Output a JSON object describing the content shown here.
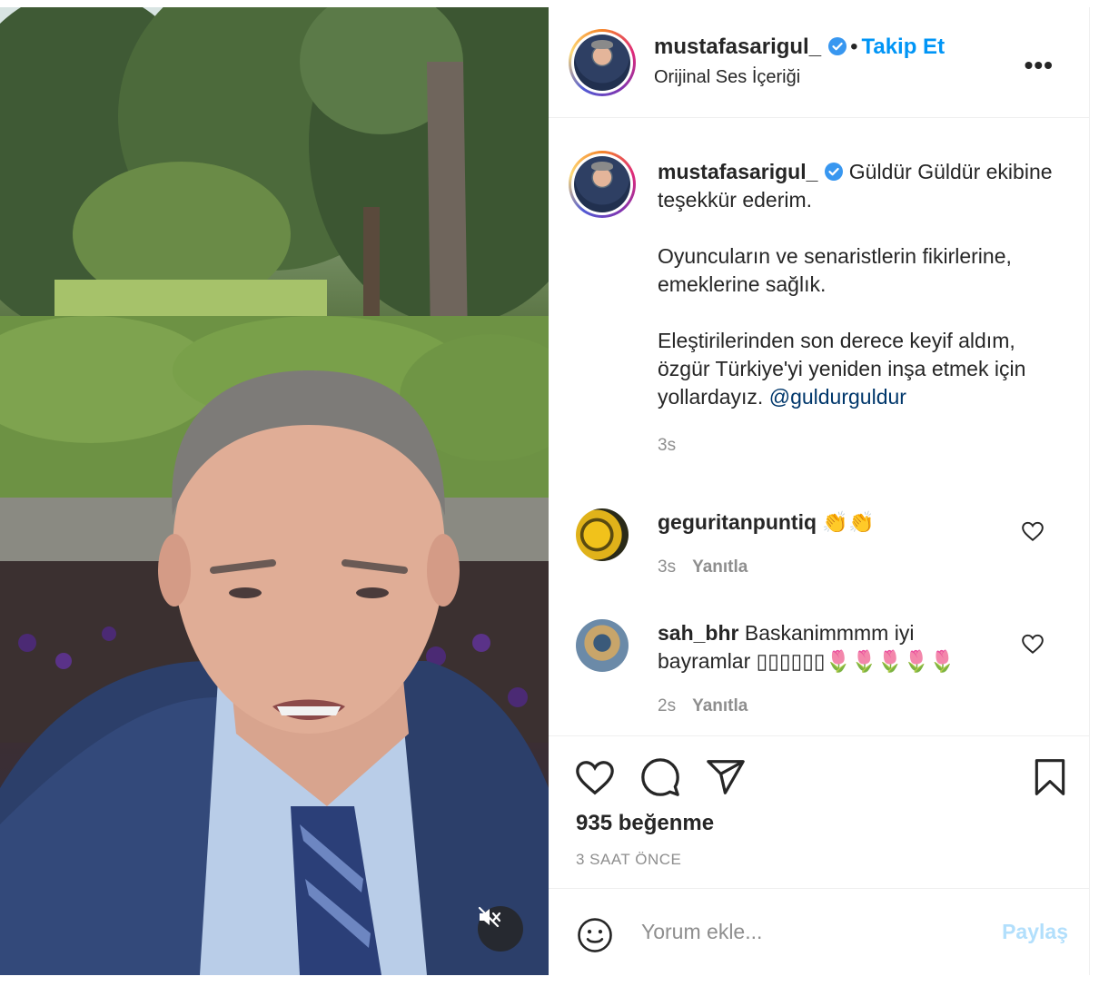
{
  "post": {
    "username": "mustafasarigul_",
    "follow_label": "Takip Et",
    "separator": "•",
    "audio_label": "Orijinal Ses İçeriği",
    "more_label": "•••"
  },
  "caption": {
    "username": "mustafasarigul_",
    "line1": "Güldür Güldür ekibine teşekkür ederim.",
    "line2": "Oyuncuların ve senaristlerin fikirlerine, emeklerine sağlık.",
    "line3": "Eleştirilerinden son derece keyif aldım, özgür Türkiye'yi yeniden inşa etmek için yollardayız.",
    "mention": "@guldurguldur",
    "time": "3s"
  },
  "comments": [
    {
      "username": "geguritanpuntiq",
      "text": "👏👏",
      "time": "3s",
      "reply": "Yanıtla"
    },
    {
      "username": "sah_bhr",
      "text": "Baskanimmmm iyi bayramlar ▯▯▯▯▯▯🌷🌷🌷🌷🌷",
      "time": "2s",
      "reply": "Yanıtla"
    }
  ],
  "stats": {
    "likes": "935 beğenme",
    "posted": "3 SAAT ÖNCE"
  },
  "add_comment": {
    "placeholder": "Yorum ekle...",
    "share_label": "Paylaş"
  },
  "colors": {
    "accent": "#0095f6",
    "verified": "#3897f0",
    "muted": "#8e8e8e",
    "share_disabled": "#b2dffc"
  },
  "icons": [
    "speaker-muted-icon",
    "verified-badge-icon",
    "more-options-icon",
    "heart-icon",
    "comment-icon",
    "share-icon",
    "bookmark-icon",
    "emoji-icon"
  ]
}
